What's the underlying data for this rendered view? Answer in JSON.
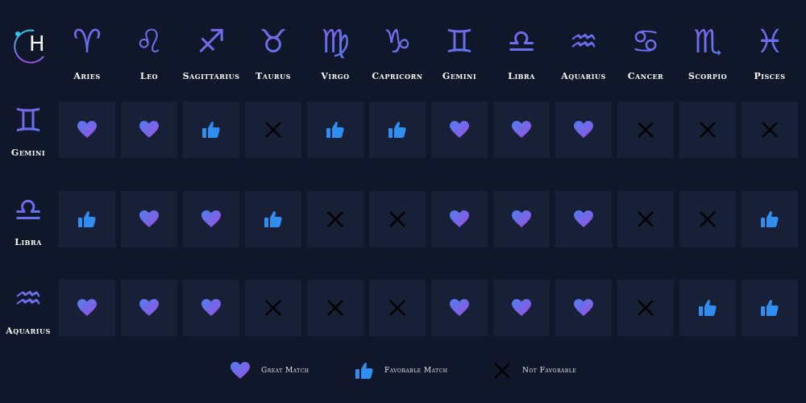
{
  "logo": {
    "letter": "H"
  },
  "columns": [
    {
      "name": "Aries",
      "glyph": "♈"
    },
    {
      "name": "Leo",
      "glyph": "♌"
    },
    {
      "name": "Sagittarius",
      "glyph": "♐"
    },
    {
      "name": "Taurus",
      "glyph": "♉"
    },
    {
      "name": "Virgo",
      "glyph": "♍"
    },
    {
      "name": "Capricorn",
      "glyph": "♑"
    },
    {
      "name": "Gemini",
      "glyph": "♊"
    },
    {
      "name": "Libra",
      "glyph": "♎"
    },
    {
      "name": "Aquarius",
      "glyph": "♒"
    },
    {
      "name": "Cancer",
      "glyph": "♋"
    },
    {
      "name": "Scorpio",
      "glyph": "♏"
    },
    {
      "name": "Pisces",
      "glyph": "♓"
    }
  ],
  "rows": [
    {
      "name": "Gemini",
      "glyph": "♊",
      "matches": [
        "great",
        "great",
        "favorable",
        "not",
        "favorable",
        "favorable",
        "great",
        "great",
        "great",
        "not",
        "not",
        "not"
      ]
    },
    {
      "name": "Libra",
      "glyph": "♎",
      "matches": [
        "favorable",
        "great",
        "great",
        "favorable",
        "not",
        "not",
        "great",
        "great",
        "great",
        "not",
        "not",
        "favorable"
      ]
    },
    {
      "name": "Aquarius",
      "glyph": "♒",
      "matches": [
        "great",
        "great",
        "great",
        "not",
        "not",
        "not",
        "great",
        "great",
        "great",
        "not",
        "favorable",
        "favorable"
      ]
    }
  ],
  "legend": [
    {
      "type": "great",
      "label": "Great Match",
      "icon": "heart-icon"
    },
    {
      "type": "favorable",
      "label": "Favorable Match",
      "icon": "thumbs-up-icon"
    },
    {
      "type": "not",
      "label": "Not Favorable",
      "icon": "x-icon"
    }
  ],
  "colors": {
    "background": "#11172a",
    "cell": "#172036",
    "heart_start": "#4f7ff0",
    "heart_end": "#9a4fe0",
    "thumb": "#2f8ef0",
    "x": "#000000"
  }
}
